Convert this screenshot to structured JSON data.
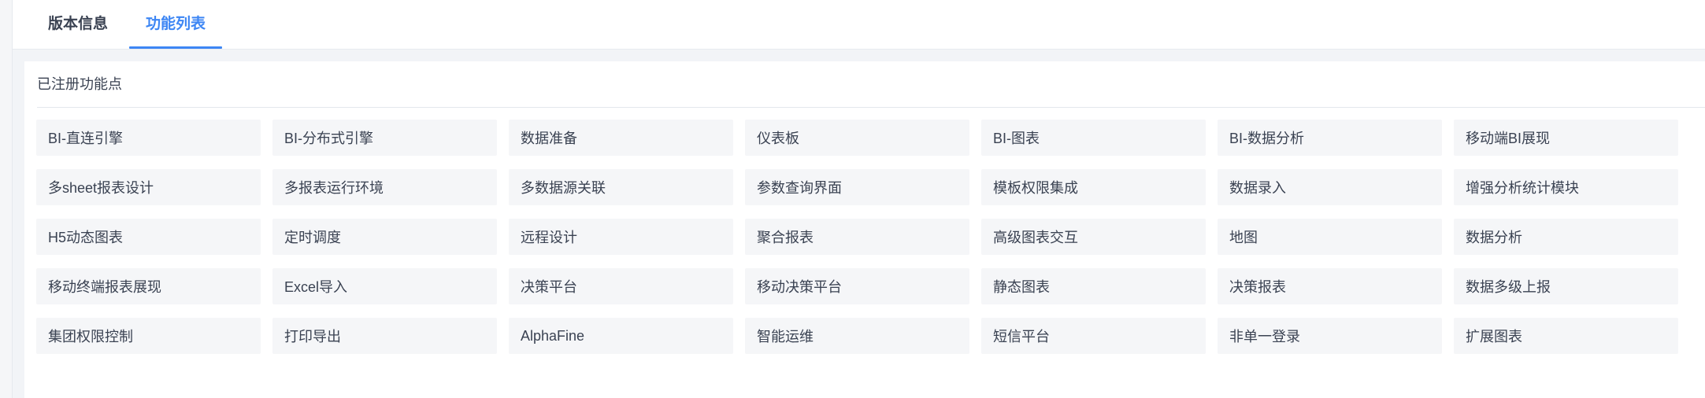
{
  "tabs": [
    {
      "label": "版本信息",
      "active": false
    },
    {
      "label": "功能列表",
      "active": true
    }
  ],
  "section": {
    "title": "已注册功能点"
  },
  "features": [
    "BI-直连引擎",
    "BI-分布式引擎",
    "数据准备",
    "仪表板",
    "BI-图表",
    "BI-数据分析",
    "移动端BI展现",
    "多sheet报表设计",
    "多报表运行环境",
    "多数据源关联",
    "参数查询界面",
    "模板权限集成",
    "数据录入",
    "增强分析统计模块",
    "H5动态图表",
    "定时调度",
    "远程设计",
    "聚合报表",
    "高级图表交互",
    "地图",
    "数据分析",
    "移动终端报表展现",
    "Excel导入",
    "决策平台",
    "移动决策平台",
    "静态图表",
    "决策报表",
    "数据多级上报",
    "集团权限控制",
    "打印导出",
    "AlphaFine",
    "智能运维",
    "短信平台",
    "非单一登录",
    "扩展图表"
  ],
  "colors": {
    "accent": "#3d86f4",
    "text": "#3a4252",
    "cell_bg": "#f5f6f8",
    "page_bg": "#f2f4f7"
  }
}
